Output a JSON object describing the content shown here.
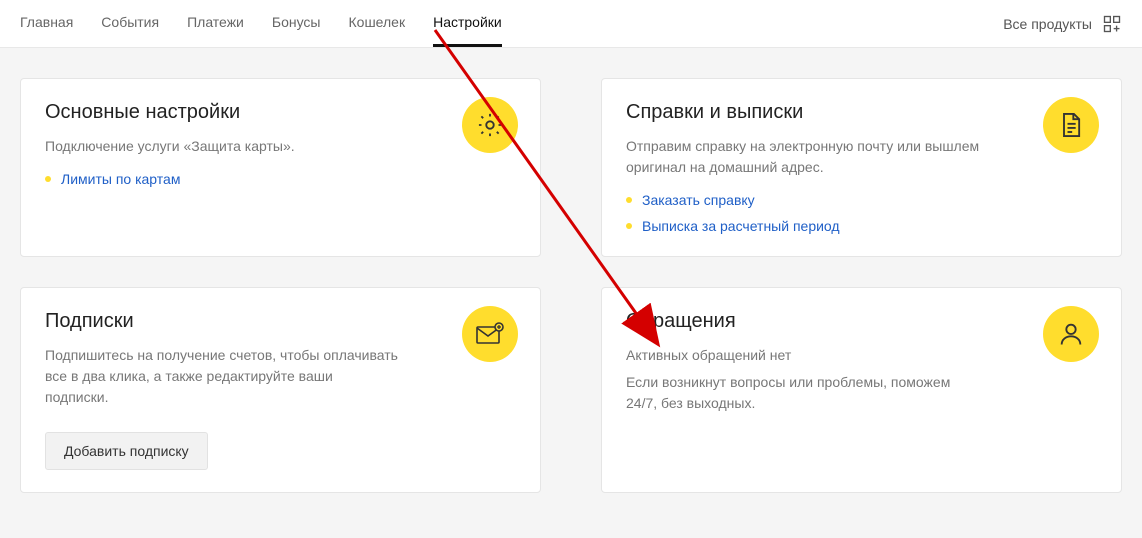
{
  "header": {
    "tabs": [
      "Главная",
      "События",
      "Платежи",
      "Бонусы",
      "Кошелек",
      "Настройки"
    ],
    "active_index": 5,
    "all_products": "Все продукты"
  },
  "cards": {
    "main_settings": {
      "title": "Основные настройки",
      "desc": "Подключение услуги «Защита карты».",
      "links": [
        "Лимиты по картам"
      ]
    },
    "statements": {
      "title": "Справки и выписки",
      "desc": "Отправим справку на электронную почту или вышлем оригинал на домашний адрес.",
      "links": [
        "Заказать справку",
        "Выписка за расчетный период"
      ]
    },
    "subscriptions": {
      "title": "Подписки",
      "desc": "Подпишитесь на получение счетов, чтобы оплачивать все в два клика, а также редактируйте ваши подписки.",
      "button": "Добавить подписку"
    },
    "requests": {
      "title": "Обращения",
      "sub": "Активных обращений нет",
      "desc": "Если возникнут вопросы или проблемы, поможем 24/7, без выходных."
    }
  },
  "colors": {
    "accent": "#ffdd2d",
    "link": "#1f5fc7",
    "arrow": "#d40000"
  }
}
